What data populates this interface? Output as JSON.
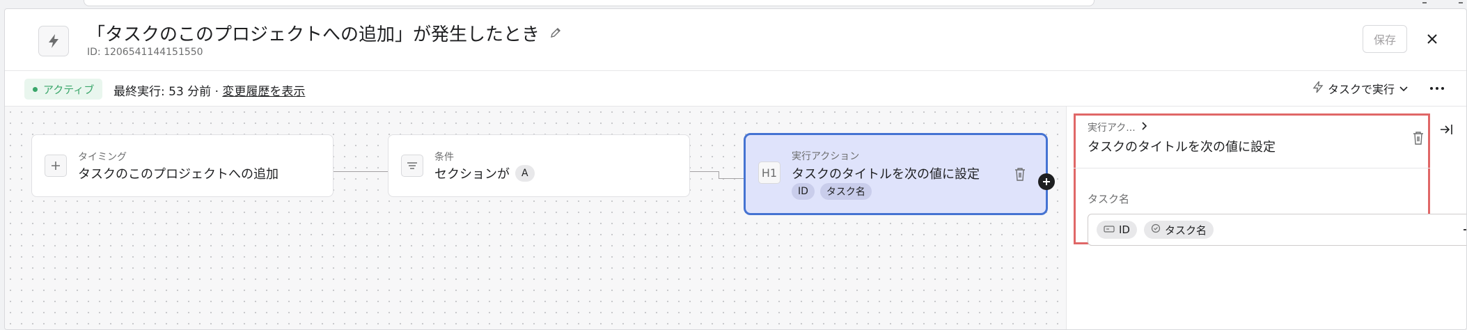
{
  "header": {
    "title": "「タスクのこのプロジェクトへの追加」が発生したとき",
    "rule_id": "ID: 1206541144151550",
    "save_label": "保存"
  },
  "status": {
    "badge": "アクティブ",
    "last_run": "最終実行: 53 分前 · ",
    "history_link": "変更履歴を表示",
    "run_dropdown": "タスクで実行"
  },
  "workflow": {
    "nodes": [
      {
        "kind": "タイミング",
        "text": "タスクのこのプロジェクトへの追加",
        "icon": "plus-icon"
      },
      {
        "kind": "条件",
        "text": "セクションが",
        "chip": "A",
        "icon": "filter-lines-icon"
      },
      {
        "kind": "実行アクション",
        "text": "タスクのタイトルを次の値に設定",
        "icon_text": "H1",
        "chips": [
          "ID",
          "タスク名"
        ]
      }
    ]
  },
  "panel": {
    "crumb": "実行アク...",
    "action_title": "タスクのタイトルを次の値に設定",
    "field_label": "タスク名",
    "field_chips": [
      "ID",
      "タスク名"
    ]
  },
  "colors": {
    "accent": "#4573d2",
    "selected_bg": "#dfe3fb",
    "highlight": "#e06767",
    "active_green": "#3aa66a"
  }
}
